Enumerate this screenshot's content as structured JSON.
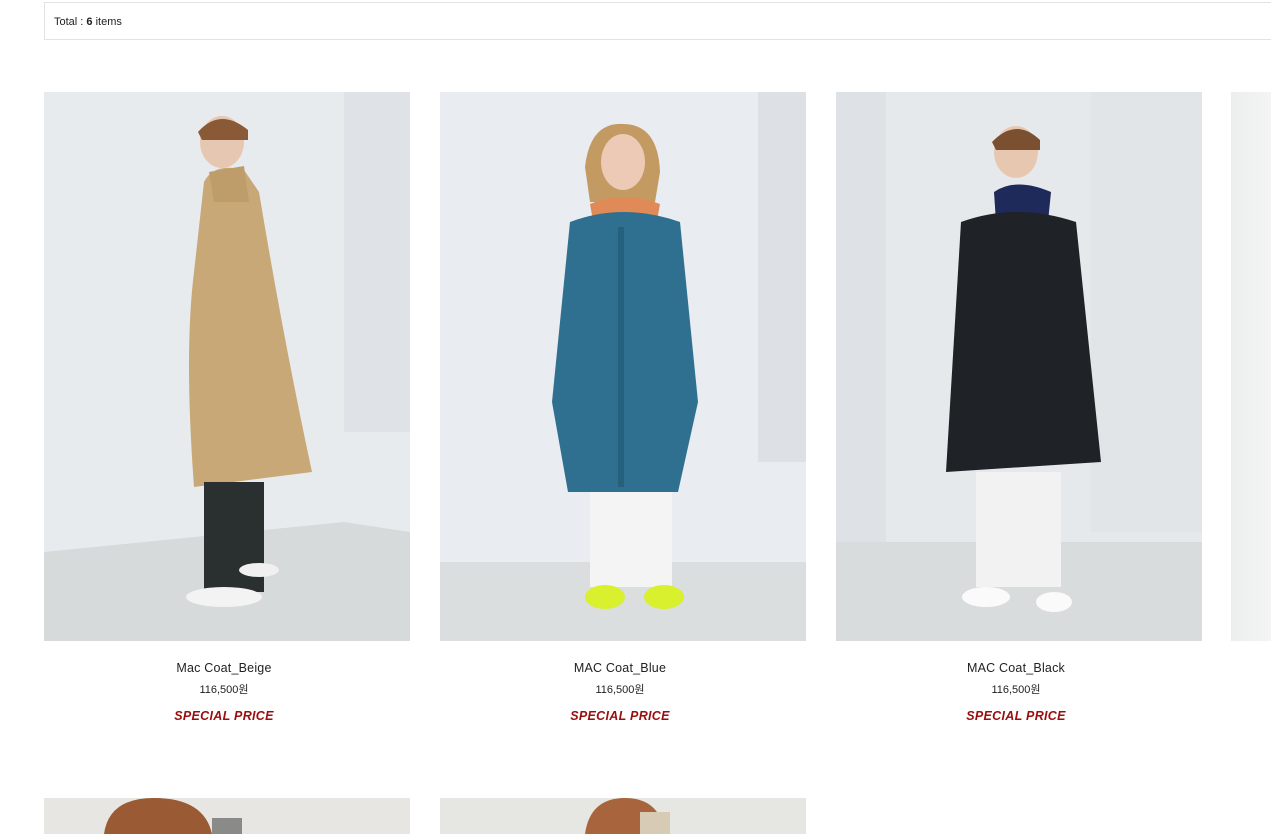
{
  "summary": {
    "total_label": "Total : ",
    "total_count": "6",
    "total_suffix": " items"
  },
  "products": [
    {
      "name": "Mac Coat_Beige",
      "price": "116,500원",
      "badge": "SPECIAL PRICE",
      "coat_color": "#c9a877"
    },
    {
      "name": "MAC Coat_Blue",
      "price": "116,500원",
      "badge": "SPECIAL PRICE",
      "coat_color": "#2f6f8f"
    },
    {
      "name": "MAC Coat_Black",
      "price": "116,500원",
      "badge": "SPECIAL PRICE",
      "coat_color": "#1f2226"
    }
  ],
  "colors": {
    "badge": "#9b0e0e",
    "border": "#e3e3e3"
  }
}
